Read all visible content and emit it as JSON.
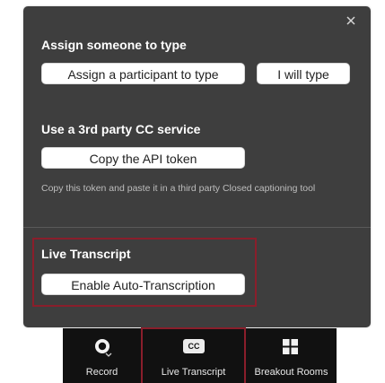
{
  "panel": {
    "close_glyph": "×",
    "assign_section": {
      "title": "Assign someone to type",
      "assign_participant_label": "Assign a participant to type",
      "i_will_type_label": "I will type"
    },
    "third_party_section": {
      "title": "Use a 3rd party CC service",
      "copy_token_label": "Copy the API token",
      "description": "Copy this token and paste it in a third party Closed captioning tool"
    },
    "live_transcript_section": {
      "title": "Live Transcript",
      "enable_label": "Enable Auto-Transcription"
    }
  },
  "toolbar": {
    "record": {
      "label": "Record",
      "icon": "record-icon"
    },
    "live_transcript": {
      "label": "Live Transcript",
      "icon": "cc-icon",
      "icon_text": "CC"
    },
    "breakout_rooms": {
      "label": "Breakout Rooms",
      "icon": "grid-icon"
    }
  },
  "colors": {
    "panel_bg": "#3e3e3e",
    "toolbar_bg": "#111111",
    "highlight": "#8a1e2b",
    "button_bg": "#ffffff",
    "text_light": "#ffffff",
    "text_muted": "#bdbdbd"
  }
}
